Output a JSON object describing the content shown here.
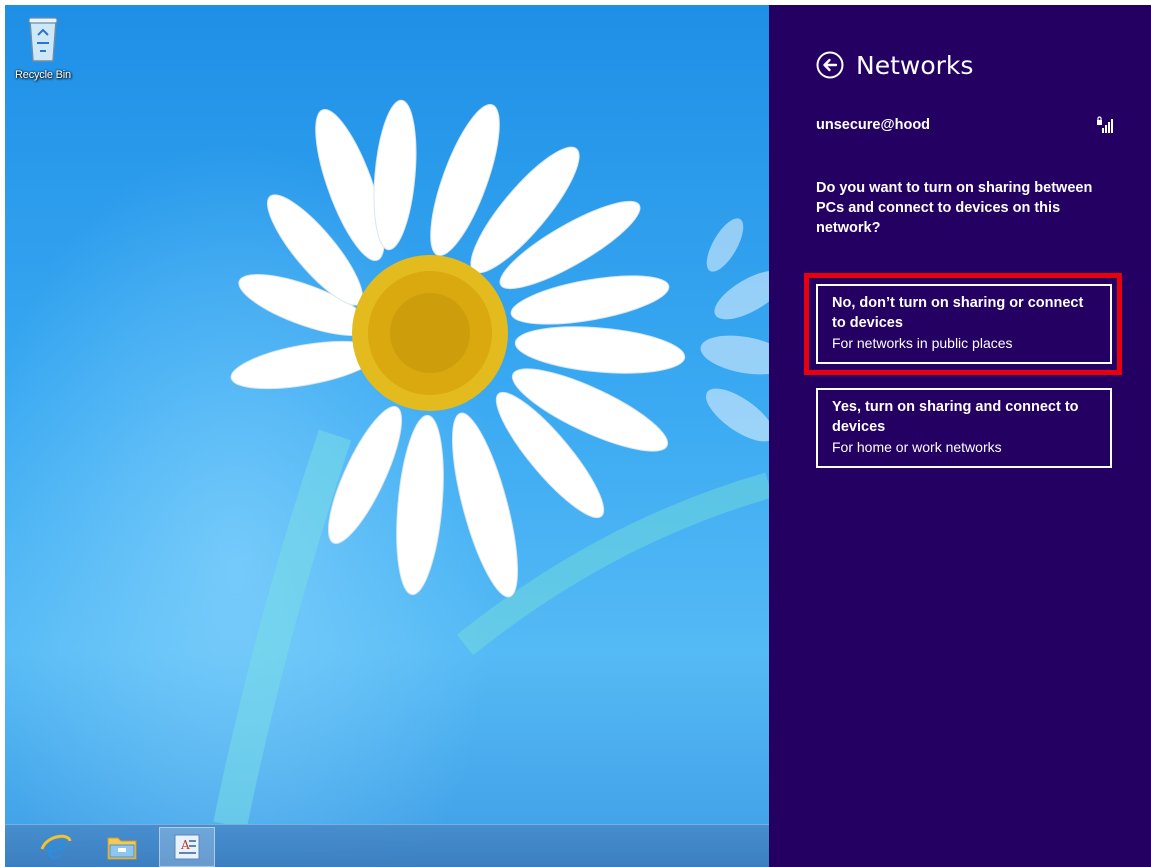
{
  "desktop": {
    "icons": [
      {
        "label": "Recycle Bin",
        "icon": "recycle-bin-icon"
      }
    ],
    "wallpaper": "daisy-flower-on-blue"
  },
  "taskbar": {
    "items": [
      {
        "name": "internet-explorer",
        "icon": "internet-explorer-icon"
      },
      {
        "name": "file-explorer",
        "icon": "folder-icon"
      },
      {
        "name": "wordpad",
        "icon": "document-app-icon",
        "active": true
      }
    ]
  },
  "panel": {
    "title": "Networks",
    "network_name": "unsecure@hood",
    "signal_icon": "wifi-signal-secured-icon",
    "question": "Do you want to turn on sharing between PCs and connect to devices on this network?",
    "options": [
      {
        "main": "No, don’t turn on sharing or connect to devices",
        "sub": "For networks in public places"
      },
      {
        "main": "Yes, turn on sharing and connect to devices",
        "sub": "For home or work networks"
      }
    ],
    "colors": {
      "background": "#230062",
      "highlight": "#e8000e"
    }
  }
}
